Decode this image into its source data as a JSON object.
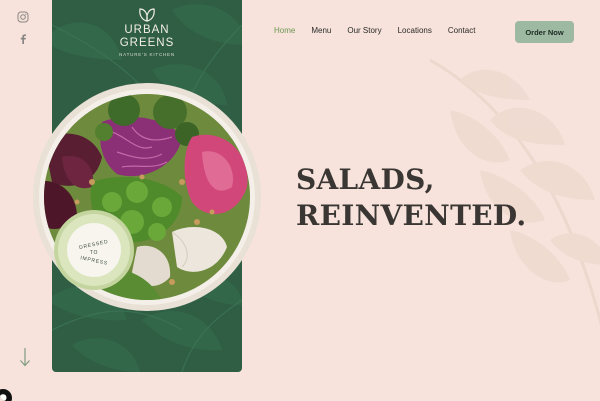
{
  "brand": {
    "line1": "URBAN",
    "line2": "GREENS",
    "tagline": "NATURE'S KITCHEN",
    "mark_icon": "leaf-pair-icon",
    "panel_color": "#2f5e44"
  },
  "social": [
    {
      "icon": "instagram-icon"
    },
    {
      "icon": "facebook-icon"
    }
  ],
  "nav": {
    "items": [
      {
        "label": "Home",
        "active": true
      },
      {
        "label": "Menu",
        "active": false
      },
      {
        "label": "Our Story",
        "active": false
      },
      {
        "label": "Locations",
        "active": false
      },
      {
        "label": "Contact",
        "active": false
      }
    ],
    "active_color": "#6f9654",
    "cta_label": "Order Now",
    "cta_color": "#9db9a2"
  },
  "hero": {
    "line1": "SALADS,",
    "line2": "REINVENTED.",
    "background": "#f7e3db"
  },
  "dressing_label": {
    "top": "DRESSED",
    "middle": "TO",
    "bottom": "IMPRESS"
  },
  "scroll_icon": "arrow-down-icon"
}
